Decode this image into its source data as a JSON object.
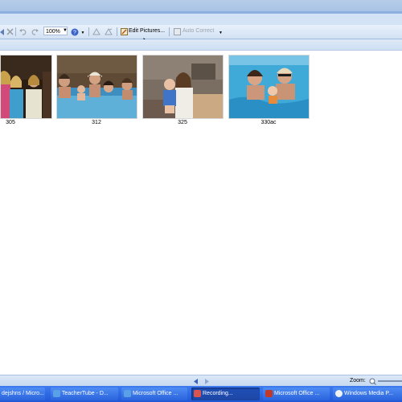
{
  "toolbar": {
    "zoom_value": "100%",
    "edit_pictures_label": "Edit Pictures...",
    "auto_correct_label": "Auto Correct"
  },
  "thumbnails": [
    {
      "caption": "305"
    },
    {
      "caption": "312"
    },
    {
      "caption": "325"
    },
    {
      "caption": "330ac"
    }
  ],
  "statusbar": {
    "zoom_label": "Zoom:"
  },
  "taskbar": {
    "items": [
      {
        "label": "dejshns / Micro..."
      },
      {
        "label": "TeacherTube - D..."
      },
      {
        "label": "Microsoft Office ..."
      },
      {
        "label": "Recording..."
      },
      {
        "label": "Microsoft Office ..."
      },
      {
        "label": "Windows Media P..."
      }
    ]
  },
  "colors": {
    "taskbar": "#2b63dc",
    "toolbar": "#d2e1f4",
    "active_task": "#1d47a5"
  }
}
